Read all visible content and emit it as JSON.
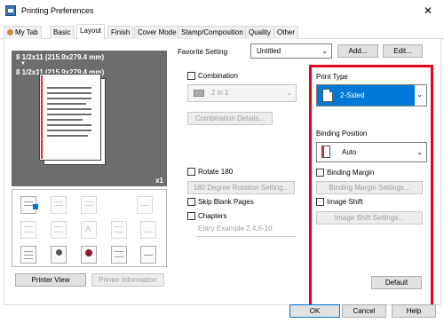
{
  "window": {
    "title": "Printing Preferences",
    "close_symbol": "✕"
  },
  "tabs": [
    {
      "label": "My Tab"
    },
    {
      "label": "Basic"
    },
    {
      "label": "Layout",
      "active": true
    },
    {
      "label": "Finish"
    },
    {
      "label": "Cover Mode"
    },
    {
      "label": "Stamp/Composition"
    },
    {
      "label": "Quality"
    },
    {
      "label": "Other"
    }
  ],
  "preview": {
    "paper_line1": "8 1/2x11 (215.9x279.4 mm)",
    "arrow": "▼",
    "paper_line2": "8 1/2x11 (215.9x279.4 mm)",
    "scale": "x1"
  },
  "preview_buttons": {
    "printer_view": "Printer View",
    "printer_information": "Printer Information"
  },
  "favorite": {
    "label": "Favorite Setting",
    "value": "Untitled",
    "add_label": "Add...",
    "edit_label": "Edit..."
  },
  "combination": {
    "label": "Combination",
    "value": "2 in 1",
    "details_label": "Combination Details..."
  },
  "rotate": {
    "label": "Rotate 180",
    "button_label": "180 Degree Rotation Setting..."
  },
  "skip_blank": {
    "label": "Skip Blank Pages"
  },
  "chapters": {
    "label": "Chapters",
    "placeholder": "Entry Example 2,4,6-10"
  },
  "print_type": {
    "label": "Print Type",
    "value": "2-Sided"
  },
  "binding_position": {
    "label": "Binding Position",
    "value": "Auto"
  },
  "binding_margin": {
    "label": "Binding Margin",
    "button_label": "Binding Margin Settings..."
  },
  "image_shift": {
    "label": "Image Shift",
    "button_label": "Image Shift Settings..."
  },
  "default_label": "Default",
  "dialog_buttons": {
    "ok": "OK",
    "cancel": "Cancel",
    "help": "Help"
  },
  "colors": {
    "accent": "#0078d7",
    "highlight": "#e8001c",
    "preview_bg": "#6d6d6d"
  }
}
